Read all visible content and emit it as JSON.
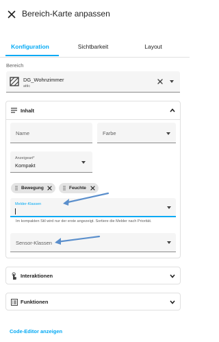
{
  "header": {
    "title": "Bereich-Karte anpassen"
  },
  "tabs": [
    {
      "label": "Konfiguration",
      "active": true
    },
    {
      "label": "Sichtbarkeit",
      "active": false
    },
    {
      "label": "Layout",
      "active": false
    }
  ],
  "area_field": {
    "label": "Bereich",
    "selected_name": "DG_Wohnzimmer",
    "selected_sub": "attic"
  },
  "inhalt": {
    "title": "Inhalt",
    "name_placeholder": "Name",
    "color_placeholder": "Farbe",
    "display_type_label": "Anzeigeart*",
    "display_type_value": "Kompakt",
    "alert_chips": [
      "Bewegung",
      "Feuchte"
    ],
    "alert_classes_label": "Melder-Klassen",
    "alert_hint": "Im kompakten Stil wird nur der erste angezeigt. Sortiere die Melder nach Priorität.",
    "sensor_classes_label": "Sensor-Klassen"
  },
  "sections": {
    "interactions": "Interaktionen",
    "features": "Funktionen"
  },
  "footer": {
    "code_editor_label": "Code-Editor anzeigen"
  },
  "colors": {
    "accent": "#03a9f4",
    "annotation_arrow": "#5b8fcc"
  }
}
